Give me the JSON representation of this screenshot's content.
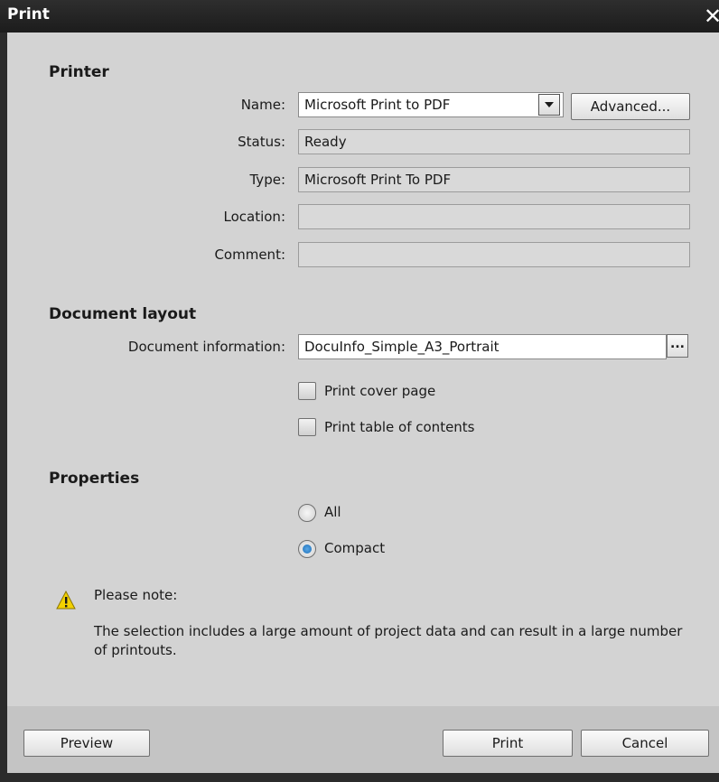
{
  "window": {
    "title": "Print",
    "close_glyph": "✕"
  },
  "printer": {
    "section_title": "Printer",
    "name_label": "Name:",
    "name_value": "Microsoft Print to PDF",
    "advanced_button": "Advanced...",
    "status_label": "Status:",
    "status_value": "Ready",
    "type_label": "Type:",
    "type_value": "Microsoft Print To PDF",
    "location_label": "Location:",
    "location_value": "",
    "comment_label": "Comment:",
    "comment_value": ""
  },
  "document_layout": {
    "section_title": "Document layout",
    "docinfo_label": "Document information:",
    "docinfo_value": "DocuInfo_Simple_A3_Portrait",
    "browse_button": "...",
    "cover_page_label": "Print cover page",
    "cover_page_checked": false,
    "toc_label": "Print table of contents",
    "toc_checked": false
  },
  "properties": {
    "section_title": "Properties",
    "option_all": "All",
    "option_compact": "Compact",
    "selected": "Compact"
  },
  "note": {
    "icon": "warning-icon",
    "heading": "Please note:",
    "text": "The selection includes a large amount of project data and can result in a large number of printouts."
  },
  "footer": {
    "preview_button": "Preview",
    "print_button": "Print",
    "cancel_button": "Cancel"
  }
}
